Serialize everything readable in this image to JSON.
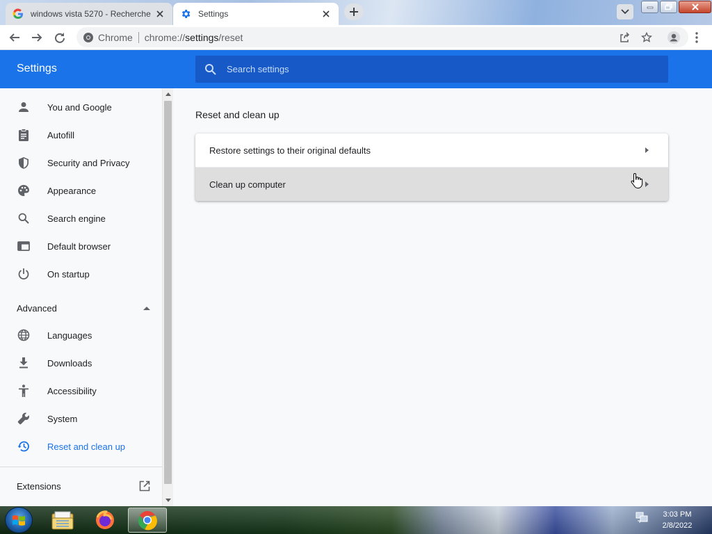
{
  "tabs": [
    {
      "title": "windows vista 5270 - Recherche",
      "active": false,
      "favicon": "google-g-icon"
    },
    {
      "title": "Settings",
      "active": true,
      "favicon": "gear-icon"
    }
  ],
  "omnibox": {
    "site_label": "Chrome",
    "url_prefix": "chrome://",
    "url_host": "settings",
    "url_path": "/reset"
  },
  "settings": {
    "header_title": "Settings",
    "search_placeholder": "Search settings",
    "nav": [
      {
        "label": "You and Google",
        "icon": "person-icon"
      },
      {
        "label": "Autofill",
        "icon": "clipboard-icon"
      },
      {
        "label": "Security and Privacy",
        "icon": "shield-icon"
      },
      {
        "label": "Appearance",
        "icon": "palette-icon"
      },
      {
        "label": "Search engine",
        "icon": "search-icon"
      },
      {
        "label": "Default browser",
        "icon": "browser-window-icon"
      },
      {
        "label": "On startup",
        "icon": "power-icon"
      }
    ],
    "advanced_label": "Advanced",
    "advanced_nav": [
      {
        "label": "Languages",
        "icon": "globe-icon"
      },
      {
        "label": "Downloads",
        "icon": "download-icon"
      },
      {
        "label": "Accessibility",
        "icon": "accessibility-icon"
      },
      {
        "label": "System",
        "icon": "wrench-icon"
      },
      {
        "label": "Reset and clean up",
        "icon": "history-icon",
        "selected": true
      }
    ],
    "extensions_label": "Extensions",
    "section_title": "Reset and clean up",
    "rows": [
      {
        "label": "Restore settings to their original defaults"
      },
      {
        "label": "Clean up computer"
      }
    ]
  },
  "taskbar": {
    "time": "3:03 PM",
    "date": "2/8/2022"
  },
  "colors": {
    "accent": "#1a73e8",
    "header": "#1a73e8",
    "search_bg": "#1659c7"
  }
}
